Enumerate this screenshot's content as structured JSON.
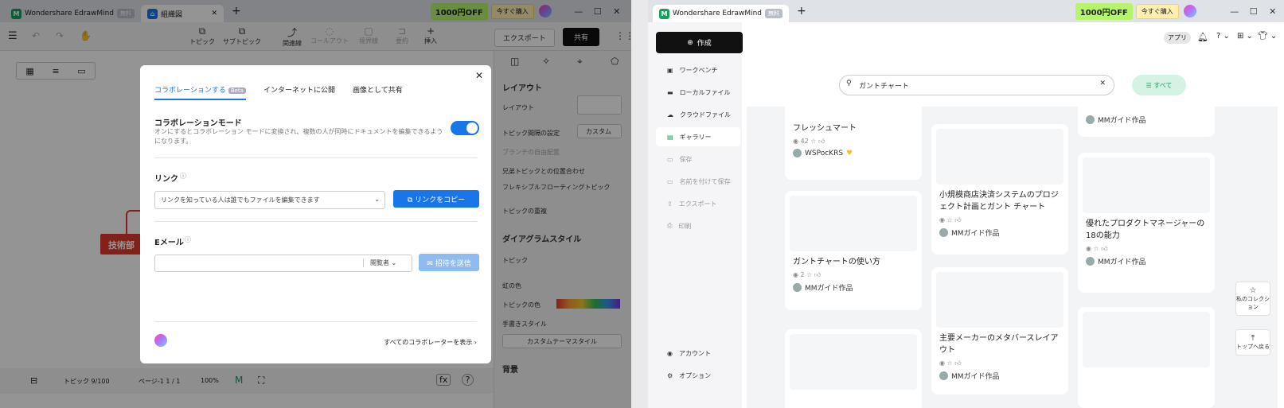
{
  "left": {
    "app_name": "Wondershare EdrawMind",
    "free_badge": "無料",
    "doc_tab": "組織図",
    "promo": "1000円OFF",
    "buy": "今すぐ購入",
    "toolbar": {
      "topic": "トピック",
      "subtopic": "サブトピック",
      "relation": "関連線",
      "callout": "コールアウト",
      "boundary": "境界線",
      "summary": "要約",
      "insert": "挿入",
      "export": "エクスポート",
      "share": "共有"
    },
    "dialog": {
      "tabs": [
        {
          "label": "コラボレーションする",
          "badge": "Beta"
        },
        {
          "label": "インターネットに公開"
        },
        {
          "label": "画像として共有"
        }
      ],
      "collab_title": "コラボレーションモード",
      "collab_desc": "オンにするとコラボレーション モードに変換され、複数の人が同時にドキュメントを編集できるようになります。",
      "link_title": "リンク",
      "link_option": "リンクを知っている人は誰でもファイルを編集できます",
      "copy_link": "リンクをコピー",
      "email_title": "Eメール",
      "role": "閲覧者",
      "send_invite": "招待を送信",
      "show_all": "すべてのコラボレーターを表示"
    },
    "right_panel": {
      "layout_title": "レイアウト",
      "layout": "レイアウト",
      "topic_spacing": "トピック間隔の設定",
      "custom": "カスタム",
      "branch_free": "ブランチの自由配置",
      "sibling_align": "兄弟トピックとの位置合わせ",
      "flexible": "フレキシブルフローティングトピック",
      "overlap": "トピックの重複",
      "diagram_style": "ダイアグラムスタイル",
      "topic": "トピック",
      "rainbow": "虹の色",
      "topic_color": "トピックの色",
      "handdrawn": "手書きスタイル",
      "custom_theme": "カスタムテーマスタイル",
      "background": "背景"
    },
    "canvas_node": "技術部",
    "bottom": {
      "topics": "トピック 9/100",
      "page": "ページ-1  1 / 1",
      "zoom": "100%"
    }
  },
  "right": {
    "app_name": "Wondershare EdrawMind",
    "free_badge": "無料",
    "promo": "1000円OFF",
    "buy": "今すぐ購入",
    "apps": "アプリ",
    "create": "作成",
    "sidebar": [
      "ワークベンチ",
      "ローカルファイル",
      "クラウドファイル",
      "ギャラリー",
      "保存",
      "名前を付けて保存",
      "エクスポート",
      "印刷"
    ],
    "sidebar_bottom": [
      "アカウント",
      "オプション"
    ],
    "search_value": "ガントチャート",
    "filter": "すべて",
    "cards": [
      {
        "title": "フレッシュマート",
        "stats": "42",
        "author": "WSPocKRS"
      },
      {
        "title": "ガントチャートの使い方",
        "stats": "2",
        "author": "MMガイド作品"
      },
      {
        "title": "小規模商店決済システムのプロジェクト計画とガント チャート",
        "stats": "",
        "author": "MMガイド作品"
      },
      {
        "title": "主要メーカーのメタバースレイアウト",
        "stats": "",
        "author": "MMガイド作品"
      },
      {
        "title": "",
        "stats": "",
        "author": "MMガイド作品"
      },
      {
        "title": "優れたプロダクトマネージャーの18の能力",
        "stats": "",
        "author": "MMガイド作品"
      }
    ],
    "float_collection": "私のコレクション",
    "float_top": "トップへ戻る"
  }
}
